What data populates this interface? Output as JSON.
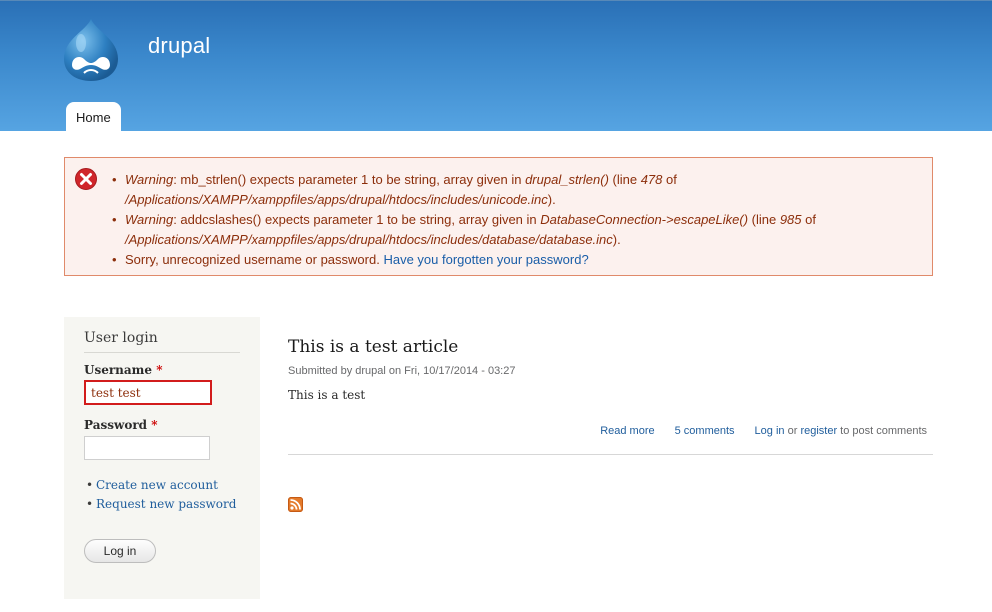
{
  "header": {
    "site_name": "drupal",
    "logo_icon": "drupal-drop-logo",
    "menu": [
      {
        "label": "Home",
        "active": true
      }
    ],
    "gradient_colors": [
      "#2a70b6",
      "#56a4e2"
    ]
  },
  "messages": {
    "type": "error",
    "icon": "error-x-icon",
    "items": [
      {
        "prefix": "Warning",
        "text1": ": mb_strlen() expects parameter 1 to be string, array given in ",
        "func": "drupal_strlen()",
        "text2": " (line ",
        "line": "478",
        "text3": " of ",
        "path": "/Applications/XAMPP/xamppfiles/apps/drupal/htdocs/includes/unicode.inc",
        "text4": ")."
      },
      {
        "prefix": "Warning",
        "text1": ": addcslashes() expects parameter 1 to be string, array given in ",
        "func": "DatabaseConnection->escapeLike()",
        "text2": " (line ",
        "line": "985",
        "text3": " of ",
        "path": "/Applications/XAMPP/xamppfiles/apps/drupal/htdocs/includes/database/database.inc",
        "text4": ")."
      },
      {
        "text": "Sorry, unrecognized username or password. ",
        "link": "Have you forgotten your password?"
      }
    ],
    "colors": {
      "background": "#fcf1ee",
      "border": "#e08a6a",
      "text": "#8c2e0b"
    }
  },
  "sidebar": {
    "block_title": "User login",
    "username_label": "Username",
    "username_value": "test test",
    "password_label": "Password",
    "password_value": "",
    "required_marker": "*",
    "links": [
      "Create new account",
      "Request new password"
    ],
    "login_button": "Log in"
  },
  "content": {
    "title": "This is a test article",
    "submitted": "Submitted by drupal on Fri, 10/17/2014 - 03:27",
    "body": "This is a test",
    "links": {
      "read_more": "Read more",
      "comments": "5 comments",
      "login": "Log in",
      "or": " or ",
      "register": "register",
      "post_comments": " to post comments"
    },
    "feed_icon": "rss-feed-icon"
  }
}
